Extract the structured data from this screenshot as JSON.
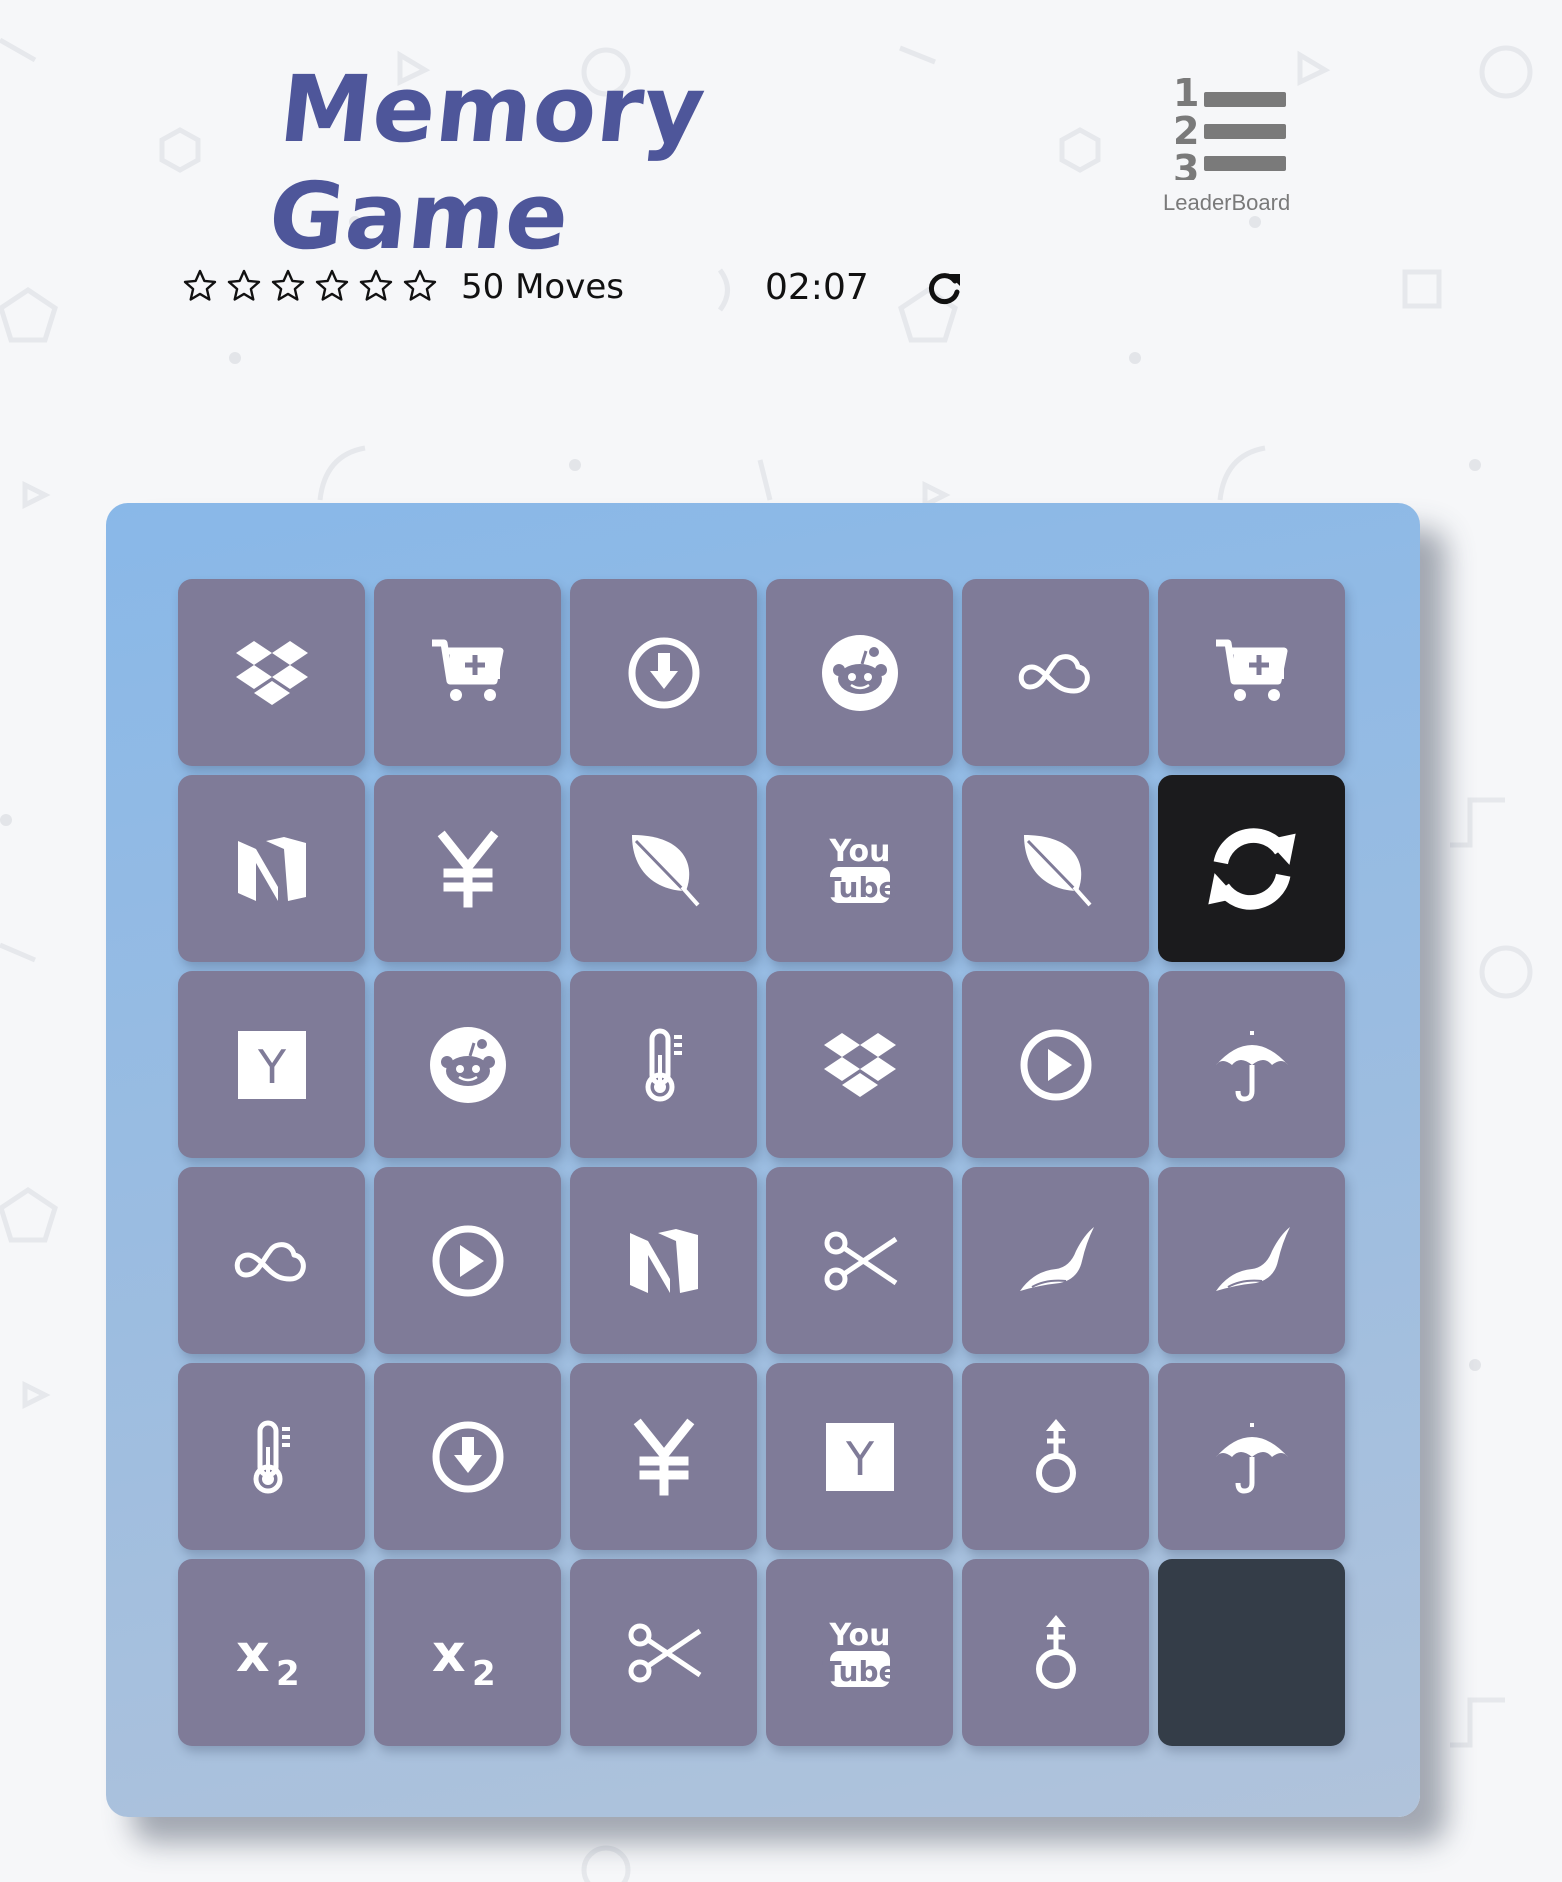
{
  "header": {
    "title": "Memory Game",
    "leaderboard_label": "LeaderBoard",
    "leaderboard_icon": "leaderboard-numbered-list-icon"
  },
  "status": {
    "stars_total": 6,
    "stars_filled": 0,
    "moves_count": "50",
    "moves_label": "Moves",
    "timer": "02:07",
    "restart_icon": "redo-icon"
  },
  "colors": {
    "title": "#4e569a",
    "card_face": "#7f7b98",
    "card_open": "#1b1b1d",
    "card_hidden": "#343d48",
    "board_top": "#89b8e8",
    "board_bottom": "#b0c3db"
  },
  "board": {
    "rows": 6,
    "cols": 6,
    "cards": [
      {
        "icon": "dropbox",
        "state": "matched"
      },
      {
        "icon": "cart-plus",
        "state": "matched"
      },
      {
        "icon": "arrow-circle-down",
        "state": "matched"
      },
      {
        "icon": "reddit",
        "state": "matched"
      },
      {
        "icon": "cloud-infinity",
        "state": "matched"
      },
      {
        "icon": "cart-plus",
        "state": "matched"
      },
      {
        "icon": "medium",
        "state": "matched"
      },
      {
        "icon": "yen",
        "state": "matched"
      },
      {
        "icon": "leaf",
        "state": "matched"
      },
      {
        "icon": "youtube",
        "state": "matched"
      },
      {
        "icon": "leaf",
        "state": "matched"
      },
      {
        "icon": "refresh",
        "state": "open"
      },
      {
        "icon": "hacker-news",
        "state": "matched"
      },
      {
        "icon": "reddit",
        "state": "matched"
      },
      {
        "icon": "thermometer",
        "state": "matched"
      },
      {
        "icon": "dropbox",
        "state": "matched"
      },
      {
        "icon": "play-circle",
        "state": "matched"
      },
      {
        "icon": "umbrella",
        "state": "matched"
      },
      {
        "icon": "cloud-infinity",
        "state": "matched"
      },
      {
        "icon": "play-circle",
        "state": "matched"
      },
      {
        "icon": "medium",
        "state": "matched"
      },
      {
        "icon": "scissors",
        "state": "matched"
      },
      {
        "icon": "pied-piper-hat",
        "state": "matched"
      },
      {
        "icon": "pied-piper-hat",
        "state": "matched"
      },
      {
        "icon": "thermometer",
        "state": "matched"
      },
      {
        "icon": "arrow-circle-down",
        "state": "matched"
      },
      {
        "icon": "yen",
        "state": "matched"
      },
      {
        "icon": "hacker-news",
        "state": "matched"
      },
      {
        "icon": "transgender-alt",
        "state": "matched"
      },
      {
        "icon": "umbrella",
        "state": "matched"
      },
      {
        "icon": "subscript",
        "state": "matched"
      },
      {
        "icon": "subscript",
        "state": "matched"
      },
      {
        "icon": "scissors",
        "state": "matched"
      },
      {
        "icon": "youtube",
        "state": "matched"
      },
      {
        "icon": "transgender-alt",
        "state": "matched"
      },
      {
        "icon": "",
        "state": "hidden"
      }
    ]
  }
}
